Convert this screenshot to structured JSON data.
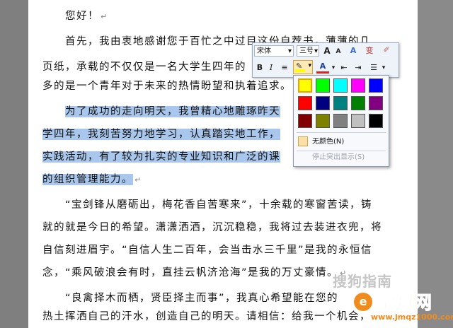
{
  "document": {
    "lines": [
      {
        "text": "您好！",
        "mark": "↵"
      },
      {
        "text": "首先，我由衷地感谢您于百忙之中过目这份自荐书，薄薄的几"
      },
      {
        "text": "页纸，承载的不仅仅是一名大学生四年的"
      },
      {
        "text": "多的是一个青年对于未来的热情盼望和执着追求。",
        "mark": "↵"
      },
      {
        "text": "为了成功的走向明天，我曾精心地雕琢昨天"
      },
      {
        "text": "学四年，我刻苦努力地学习，认真踏实地工作，"
      },
      {
        "text": "实践活动，有了较为扎实的专业知识和广泛的课"
      },
      {
        "text": "的组织管理能力。",
        "mark": "↵"
      },
      {
        "text": "“宝剑锋从磨砺出，梅花香自苦寒来”，十余载的寒窗苦读，铸"
      },
      {
        "text": "就的就是今日的希望。潇潇洒洒，沉沉稳稳，我将过去装进衣兜，将"
      },
      {
        "text": "自信刻进眉宇。“自信人生二百年，会当击水三千里”是我的永恒信"
      },
      {
        "text": "念，“乘风破浪会有时，直挂云帆济沧海”是我的万丈豪情。",
        "mark": "↵"
      },
      {
        "text": "“良禽择木而栖，贤臣择主而事”，我真心希望能在您的"
      },
      {
        "text": "热土挥洒自己的汗水，创造自己的明天。请相信：给我一个机会，"
      }
    ]
  },
  "toolbar": {
    "font_name": "宋体",
    "font_size": "三号",
    "grow_font": "A",
    "shrink_font": "A",
    "styles": "A",
    "format_painter": "✐",
    "bold": "B",
    "italic": "I",
    "align": "≡",
    "font_color": "A",
    "decrease_indent": "⇤",
    "increase_indent": "⇥",
    "bullets": "☰",
    "dropdown": "▾"
  },
  "palette": {
    "colors": [
      "#ffff00",
      "#00ff00",
      "#00ffff",
      "#ff00ff",
      "#0000ff",
      "#ff0000",
      "#000080",
      "#008080",
      "#008000",
      "#800080",
      "#800000",
      "#808000",
      "#808080",
      "#c0c0c0",
      "#000000"
    ],
    "no_color_label": "无颜色(N)",
    "stop_highlight_label": "停止突出显示(S)"
  },
  "watermark": {
    "text1": "学知网",
    "text2": "www.jmqz1000.com",
    "faint": "搜狗指南"
  },
  "colors": {
    "selection": "#a9c7ec",
    "highlight_yellow": "#ffff00",
    "watermark_orange": "#f08c1e"
  }
}
